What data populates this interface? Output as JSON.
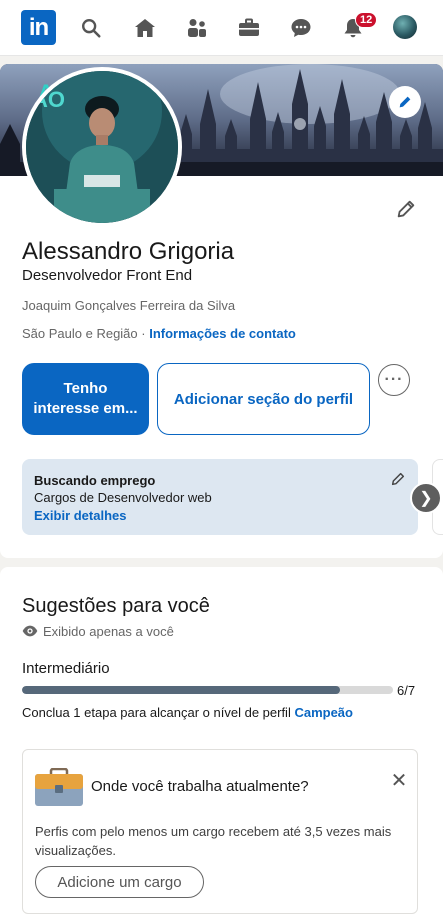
{
  "nav": {
    "logo_text": "in",
    "notifications_badge": "12",
    "icons": [
      "search-icon",
      "home-icon",
      "network-icon",
      "jobs-icon",
      "messaging-icon",
      "notifications-icon",
      "me-avatar"
    ]
  },
  "profile": {
    "name": "Alessandro Grigoria",
    "headline": "Desenvolvedor Front End",
    "school": "Joaquim Gonçalves Ferreira da Silva",
    "location": "São Paulo e Região",
    "separator": " · ",
    "contact_link": "Informações de contato",
    "banner_text": "AO",
    "primary_button": "Tenho interesse em...",
    "secondary_button": "Adicionar seção do perfil",
    "more_button": "···"
  },
  "open_to_work": {
    "title": "Buscando emprego",
    "description": "Cargos de Desenvolvedor web",
    "link": "Exibir detalhes",
    "next_arrow": "❯"
  },
  "suggestions": {
    "title": "Sugestões para você",
    "private_note": "Exibido apenas a você",
    "level": "Intermediário",
    "progress_done": 6,
    "progress_total": 7,
    "progress_label": "6/7",
    "hint_prefix": "Conclua 1 etapa para alcançar o nível de perfil ",
    "hint_level": "Campeão",
    "prompt": {
      "title": "Onde você trabalha atualmente?",
      "description": "Perfis com pelo menos um cargo recebem até 3,5 vezes mais visualizações.",
      "button": "Adicione um cargo",
      "close": "✕"
    }
  },
  "colors": {
    "brand": "#0a66c2",
    "badge": "#cb112d",
    "progress": "#56687a",
    "open_to_work_bg": "#dde7f1"
  }
}
